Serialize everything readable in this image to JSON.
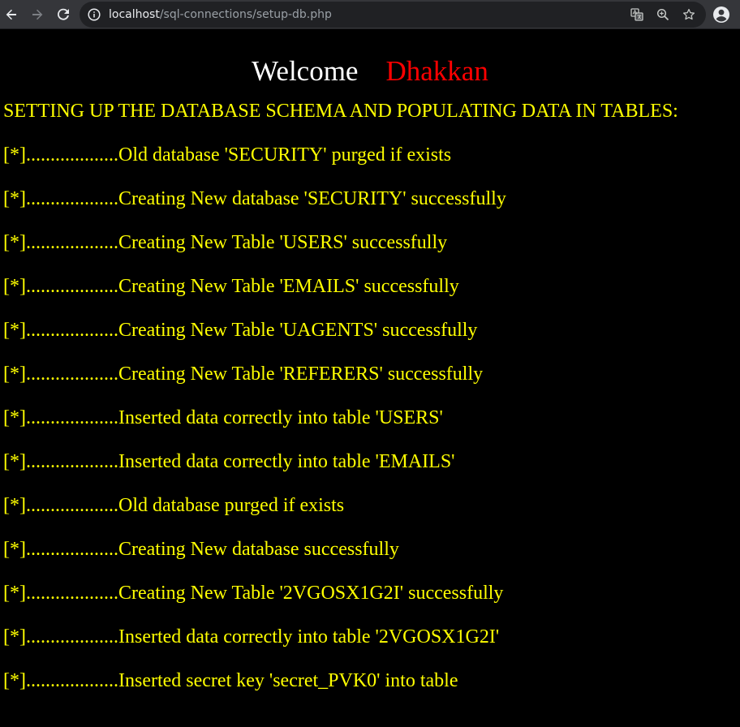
{
  "browser": {
    "url_host": "localhost",
    "url_path": "/sql-connections/setup-db.php",
    "icons": [
      "back-arrow",
      "forward-arrow",
      "reload",
      "info",
      "translate",
      "zoom",
      "bookmark-star",
      "profile"
    ]
  },
  "page": {
    "welcome": "Welcome",
    "user_name": "Dhakkan",
    "heading": "SETTING UP THE DATABASE SCHEMA AND POPULATING DATA IN TABLES:",
    "lines": [
      "[*]...................Old database 'SECURITY' purged if exists",
      "[*]...................Creating New database 'SECURITY' successfully",
      "[*]...................Creating New Table 'USERS' successfully",
      "[*]...................Creating New Table 'EMAILS' successfully",
      "[*]...................Creating New Table 'UAGENTS' successfully",
      "[*]...................Creating New Table 'REFERERS' successfully",
      "[*]...................Inserted data correctly into table 'USERS'",
      "[*]...................Inserted data correctly into table 'EMAILS'",
      "[*]...................Old database purged if exists",
      "[*]...................Creating New database successfully",
      "[*]...................Creating New Table '2VGOSX1G2I' successfully",
      "[*]...................Inserted data correctly into table '2VGOSX1G2I'",
      "[*]...................Inserted secret key 'secret_PVK0' into table"
    ]
  },
  "colors": {
    "background": "#000000",
    "welcome": "#ffffff",
    "user_name": "#ff0000",
    "status_text": "#ffff00",
    "toolbar": "#35363a",
    "omnibox": "#202124"
  }
}
